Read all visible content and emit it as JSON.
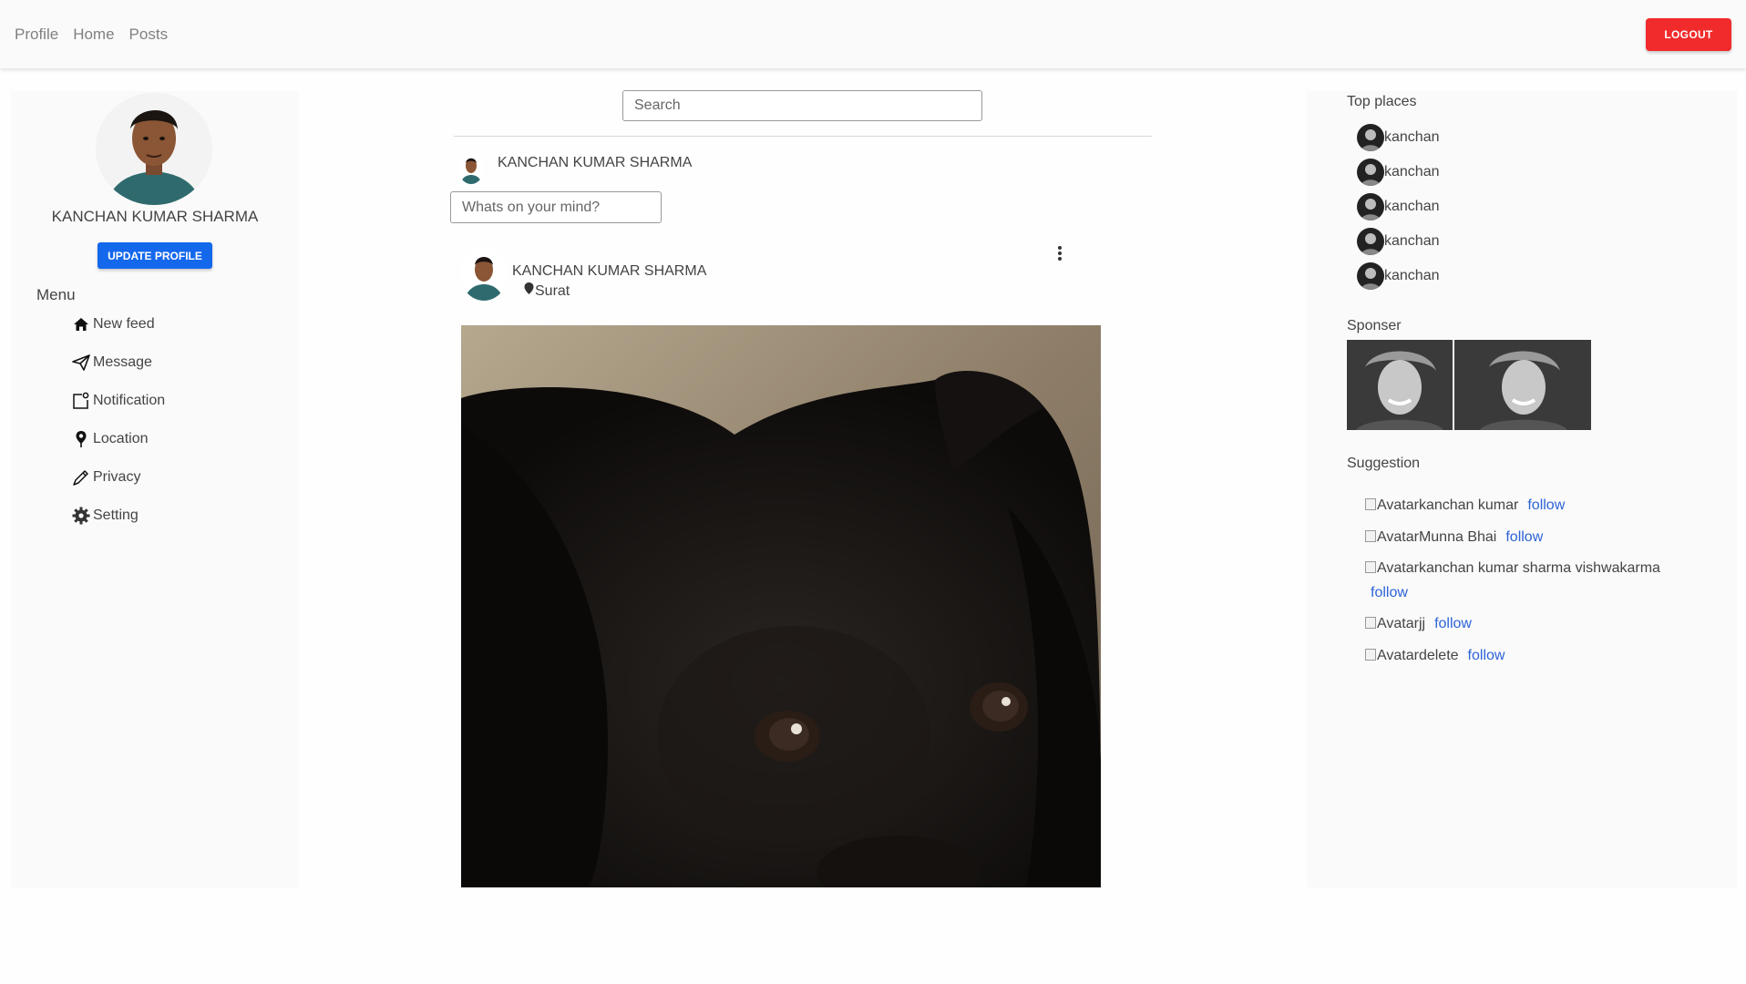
{
  "nav": {
    "items": [
      "Profile",
      "Home",
      "Posts"
    ],
    "logout": "LOGOUT"
  },
  "profile": {
    "name": "KANCHAN KUMAR SHARMA",
    "update_label": "UPDATE PROFILE"
  },
  "menu": {
    "title": "Menu",
    "items": [
      {
        "label": "New feed",
        "icon": "home-icon"
      },
      {
        "label": "Message",
        "icon": "send-icon"
      },
      {
        "label": "Notification",
        "icon": "notification-icon"
      },
      {
        "label": "Location",
        "icon": "location-pin-icon"
      },
      {
        "label": "Privacy",
        "icon": "pen-icon"
      },
      {
        "label": "Setting",
        "icon": "gear-icon"
      }
    ]
  },
  "feed": {
    "search_placeholder": "Search",
    "composer_name": "KANCHAN KUMAR SHARMA",
    "composer_placeholder": "Whats on your mind?",
    "post": {
      "author": "KANCHAN KUMAR SHARMA",
      "location": "Surat"
    }
  },
  "top_places": {
    "title": "Top places",
    "items": [
      "kanchan",
      "kanchan",
      "kanchan",
      "kanchan",
      "kanchan"
    ]
  },
  "sponsor": {
    "title": "Sponser"
  },
  "suggestion": {
    "title": "Suggestion",
    "alt_text": "Avatar",
    "follow_label": "follow",
    "items": [
      "kanchan kumar",
      "Munna Bhai",
      "kanchan kumar sharma vishwakarma",
      "jj",
      "delete"
    ]
  },
  "colors": {
    "logout": "#f12b2b",
    "primary": "#1468ec",
    "link": "#2c63d8"
  }
}
